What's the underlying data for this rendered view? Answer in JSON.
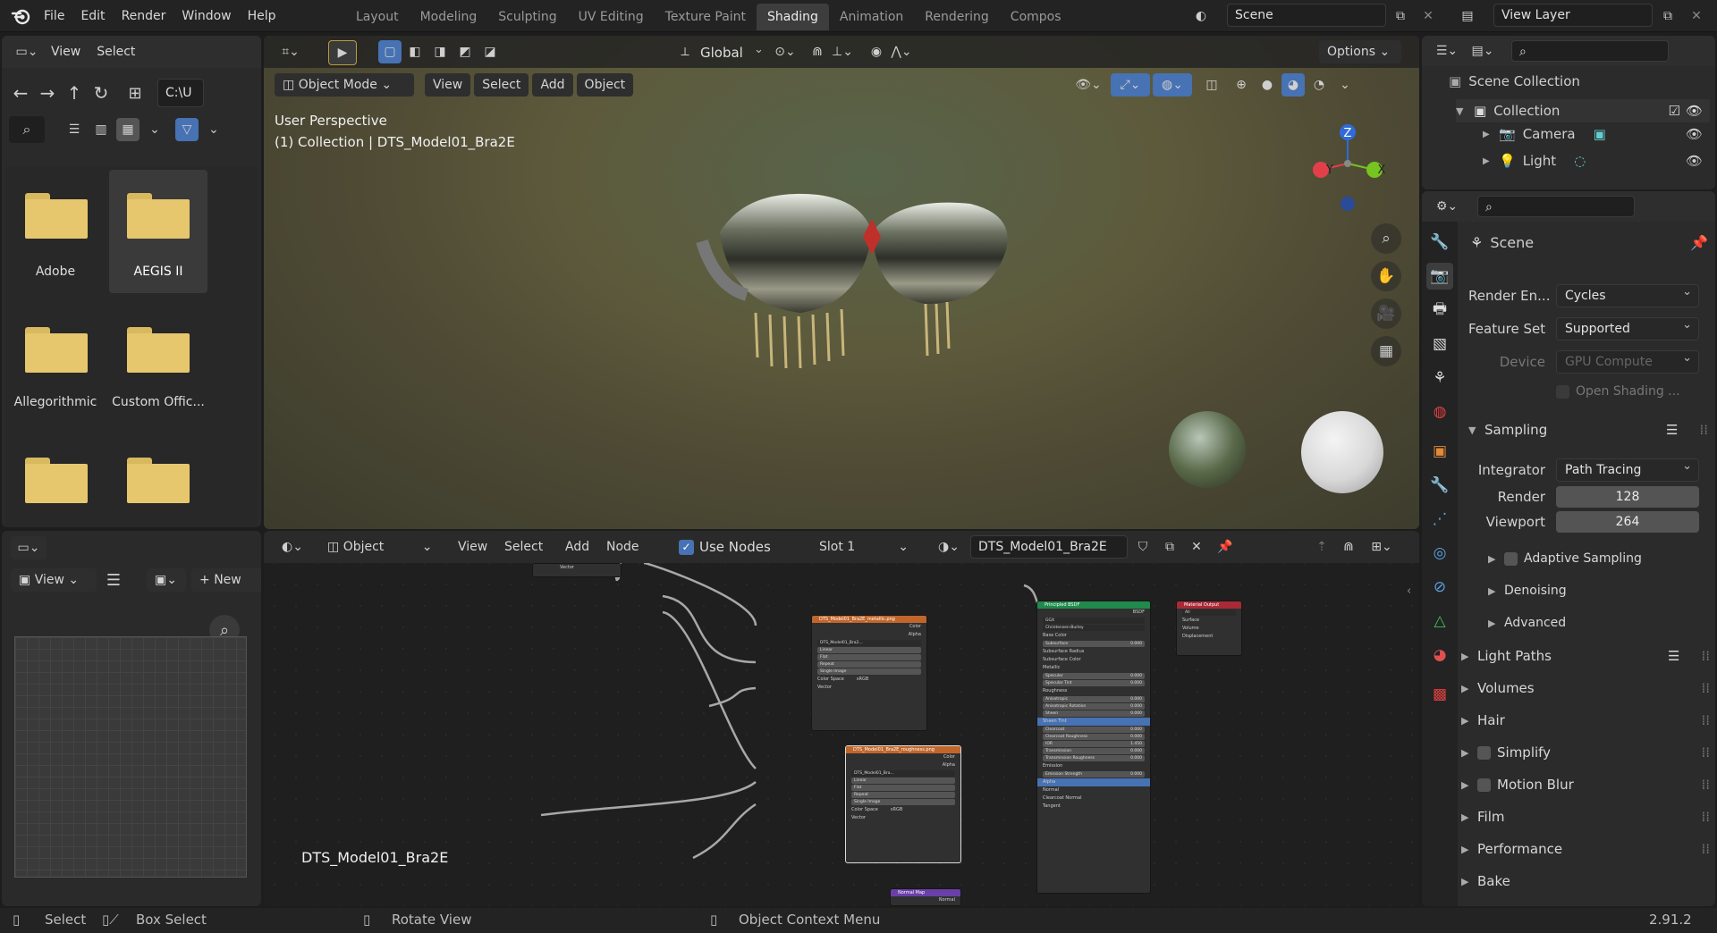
{
  "menus": [
    "File",
    "Edit",
    "Render",
    "Window",
    "Help"
  ],
  "workspaces": [
    "Layout",
    "Modeling",
    "Sculpting",
    "UV Editing",
    "Texture Paint",
    "Shading",
    "Animation",
    "Rendering",
    "Compos"
  ],
  "active_workspace": "Shading",
  "scene_name": "Scene",
  "view_layer": "View Layer",
  "file_browser": {
    "menu": [
      "View",
      "Select"
    ],
    "path": "C:\\U",
    "folders": [
      "Adobe",
      "AEGIS II",
      "Allegorithmic",
      "Custom Offic...",
      "",
      ""
    ],
    "selected": "AEGIS II"
  },
  "image_editor": {
    "view_label": "View",
    "new_label": "New",
    "name_label": "DTS_Model01_Bra2E"
  },
  "viewport": {
    "toolbar": {
      "orientation": "Global",
      "options": "Options"
    },
    "header": {
      "mode": "Object Mode",
      "menus": [
        "View",
        "Select",
        "Add",
        "Object"
      ]
    },
    "info_line1": "User Perspective",
    "info_line2": "(1) Collection | DTS_Model01_Bra2E",
    "gizmo": {
      "z": "Z",
      "y": "Y",
      "x": "X"
    }
  },
  "node_editor": {
    "type": "Object",
    "menus": [
      "View",
      "Select",
      "Add",
      "Node"
    ],
    "use_nodes_label": "Use Nodes",
    "slot": "Slot 1",
    "material": "DTS_Model01_Bra2E",
    "label": "DTS_Model01_Bra2E",
    "tex1": {
      "title": "DTS_Model01_Bra2E_metallic.png",
      "image": "DTS_Model01_Bra2...",
      "rows": [
        "Color",
        "Alpha"
      ],
      "fields": [
        "Linear",
        "Flat",
        "Repeat",
        "Single Image"
      ],
      "colorspace": "Color Space",
      "colorspace_val": "sRGB",
      "vector": "Vector"
    },
    "tex2": {
      "title": "DTS_Model01_Bra2E_roughness.png",
      "image": "DTS_Model01_Bra...",
      "rows": [
        "Color",
        "Alpha"
      ],
      "fields": [
        "Linear",
        "Flat",
        "Repeat",
        "Single Image"
      ],
      "colorspace": "Color Space",
      "colorspace_val": "sRGB",
      "vector": "Vector"
    },
    "bsdf": {
      "title": "Principled BSDF",
      "out": "BSDF",
      "dist": "GGX",
      "sss": "Christensen-Burley",
      "rows": [
        "Base Color",
        "Subsurface",
        "Subsurface Radius",
        "Subsurface Color",
        "Metallic",
        "Specular",
        "Specular Tint",
        "Roughness",
        "Anisotropic",
        "Anisotropic Rotation",
        "Sheen",
        "Sheen Tint",
        "Clearcoat",
        "Clearcoat Roughness",
        "IOR",
        "Transmission",
        "Transmission Roughness",
        "Emission",
        "Emission Strength",
        "Alpha",
        "Normal",
        "Clearcoat Normal",
        "Tangent"
      ],
      "vals": [
        "",
        "0.000",
        "",
        "",
        "",
        "0.000",
        "0.000",
        "",
        "0.000",
        "0.000",
        "0.000",
        "",
        "0.000",
        "0.000",
        "1.450",
        "0.000",
        "0.000",
        "",
        "0.000",
        "",
        "",
        "",
        ""
      ]
    },
    "output": {
      "title": "Material Output",
      "target": "All",
      "rows": [
        "Surface",
        "Volume",
        "Displacement"
      ]
    },
    "normal_map": {
      "title": "Normal Map",
      "row": "Normal"
    },
    "top_vector": "Vector"
  },
  "outliner": {
    "items": [
      {
        "label": "Scene Collection"
      },
      {
        "label": "Collection"
      },
      {
        "label": "Camera"
      },
      {
        "label": "Light"
      }
    ]
  },
  "properties": {
    "context": "Scene",
    "render_engine_label": "Render En...",
    "render_engine": "Cycles",
    "feature_set_label": "Feature Set",
    "feature_set": "Supported",
    "device_label": "Device",
    "device": "GPU Compute",
    "open_shading": "Open Shading ...",
    "sampling": "Sampling",
    "integrator_label": "Integrator",
    "integrator": "Path Tracing",
    "render_label": "Render",
    "render_samples": "128",
    "viewport_label": "Viewport",
    "viewport_samples": "264",
    "subpanels": [
      "Adaptive Sampling",
      "Denoising",
      "Advanced"
    ],
    "panels": [
      "Light Paths",
      "Volumes",
      "Hair",
      "Simplify",
      "Motion Blur",
      "Film",
      "Performance",
      "Bake"
    ]
  },
  "statusbar": {
    "select": "Select",
    "box_select": "Box Select",
    "rotate": "Rotate View",
    "context_menu": "Object Context Menu",
    "version": "2.91.2"
  },
  "colors": {
    "accent": "#4772b3",
    "folder": "#e6c76d",
    "active_tab": "#3d3d3d"
  }
}
